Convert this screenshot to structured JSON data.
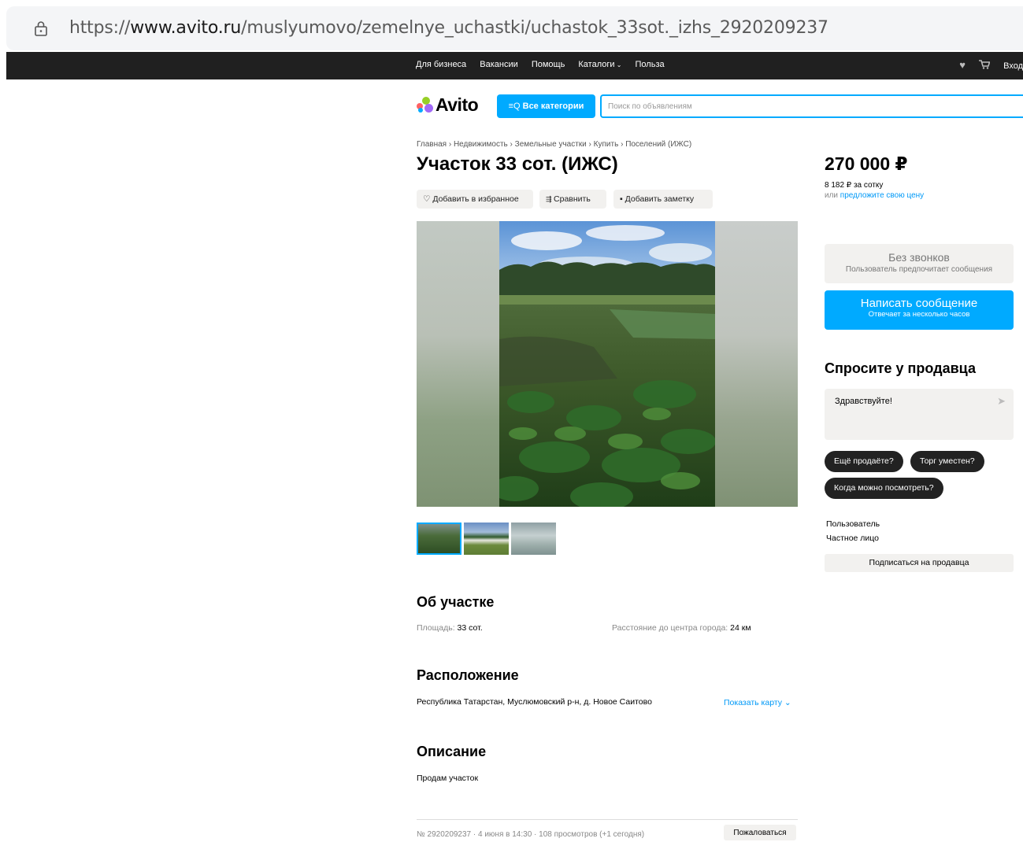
{
  "browser": {
    "url_prefix": "https://",
    "url_host": "www.avito.ru",
    "url_path": "/muslyumovo/zemelnye_uchastki/uchastok_33sot._izhs_2920209237"
  },
  "topnav": {
    "links": [
      "Для бизнеса",
      "Вакансии",
      "Помощь",
      "Каталоги",
      "Польза"
    ],
    "login": "Вход"
  },
  "header": {
    "logo": "Avito",
    "categories_button": "Все категории",
    "search_placeholder": "Поиск по объявлениям"
  },
  "breadcrumbs": [
    "Главная",
    "Недвижимость",
    "Земельные участки",
    "Купить",
    "Поселений (ИЖС)"
  ],
  "listing": {
    "title": "Участок 33 сот. (ИЖС)",
    "actions": {
      "favorite": "Добавить в избранное",
      "compare": "Сравнить",
      "note": "Добавить заметку"
    },
    "about_heading": "Об участке",
    "area_label": "Площадь:",
    "area_value": "33 сот.",
    "distance_label": "Расстояние до центра города:",
    "distance_value": "24 км",
    "location_heading": "Расположение",
    "address": "Республика Татарстан, Муслюмовский р-н, д. Новое Саитово",
    "show_map": "Показать карту",
    "description_heading": "Описание",
    "description": "Продам участок",
    "footer_info": "№ 2920209237 · 4 июня в 14:30 · 108 просмотров (+1 сегодня)",
    "complain": "Пожаловаться"
  },
  "sidebar": {
    "price": "270 000 ₽",
    "per_sotka": "8 182 ₽ за сотку",
    "offer_prefix": "или",
    "offer_link": "предложите свою цену",
    "no_calls_title": "Без звонков",
    "no_calls_sub": "Пользователь предпочитает сообщения",
    "write_title": "Написать сообщение",
    "write_sub": "Отвечает за несколько часов",
    "ask_heading": "Спросите у продавца",
    "message_text": "Здравствуйте!",
    "quick_questions": [
      "Ещё продаёте?",
      "Торг уместен?",
      "Когда можно посмотреть?"
    ],
    "seller_name": "Пользователь",
    "seller_type": "Частное лицо",
    "subscribe": "Подписаться на продавца"
  },
  "colors": {
    "accent": "#00aaff",
    "link": "#0099f7",
    "nav_bg": "#202020",
    "chip_bg": "#222222",
    "soft_bg": "#f2f1ef"
  }
}
